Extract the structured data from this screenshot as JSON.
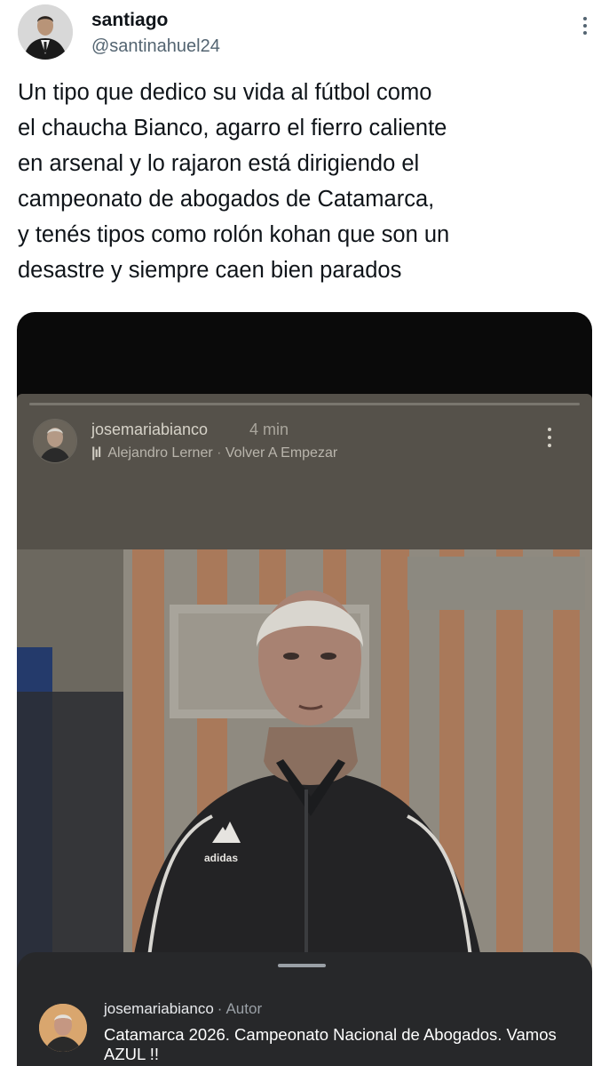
{
  "tweet": {
    "author_name": "santiago",
    "author_handle": "@santinahuel24",
    "text": "Un tipo que dedico su vida al fútbol como\nel chaucha Bianco, agarro el fierro caliente\nen arsenal y lo rajaron está dirigiendo el\ncampeonato de abogados de Catamarca,\ny tenés tipos como rolón kohan que son un\ndesastre y siempre caen bien parados"
  },
  "story": {
    "username": "josemariabianco",
    "time": "4 min",
    "music_artist": "Alejandro Lerner",
    "music_separator": " · ",
    "music_song": "Volver A Empezar",
    "apparel_logo_text": "adidas"
  },
  "comment": {
    "username": "josemariabianco",
    "role": "Autor",
    "text": "Catamarca 2026. Campeonato Nacional de Abogados. Vamos AZUL !!"
  },
  "colors": {
    "page_bg": "#ffffff",
    "text_primary": "#0f1419",
    "text_secondary": "#536471",
    "media_bg": "#0a0a0a",
    "story_overlay": "#55514a",
    "comment_sheet": "#27282a"
  },
  "icons": {
    "tweet_more": "more-vertical-icon",
    "music": "music-note-icon",
    "story_more": "more-vertical-icon"
  }
}
